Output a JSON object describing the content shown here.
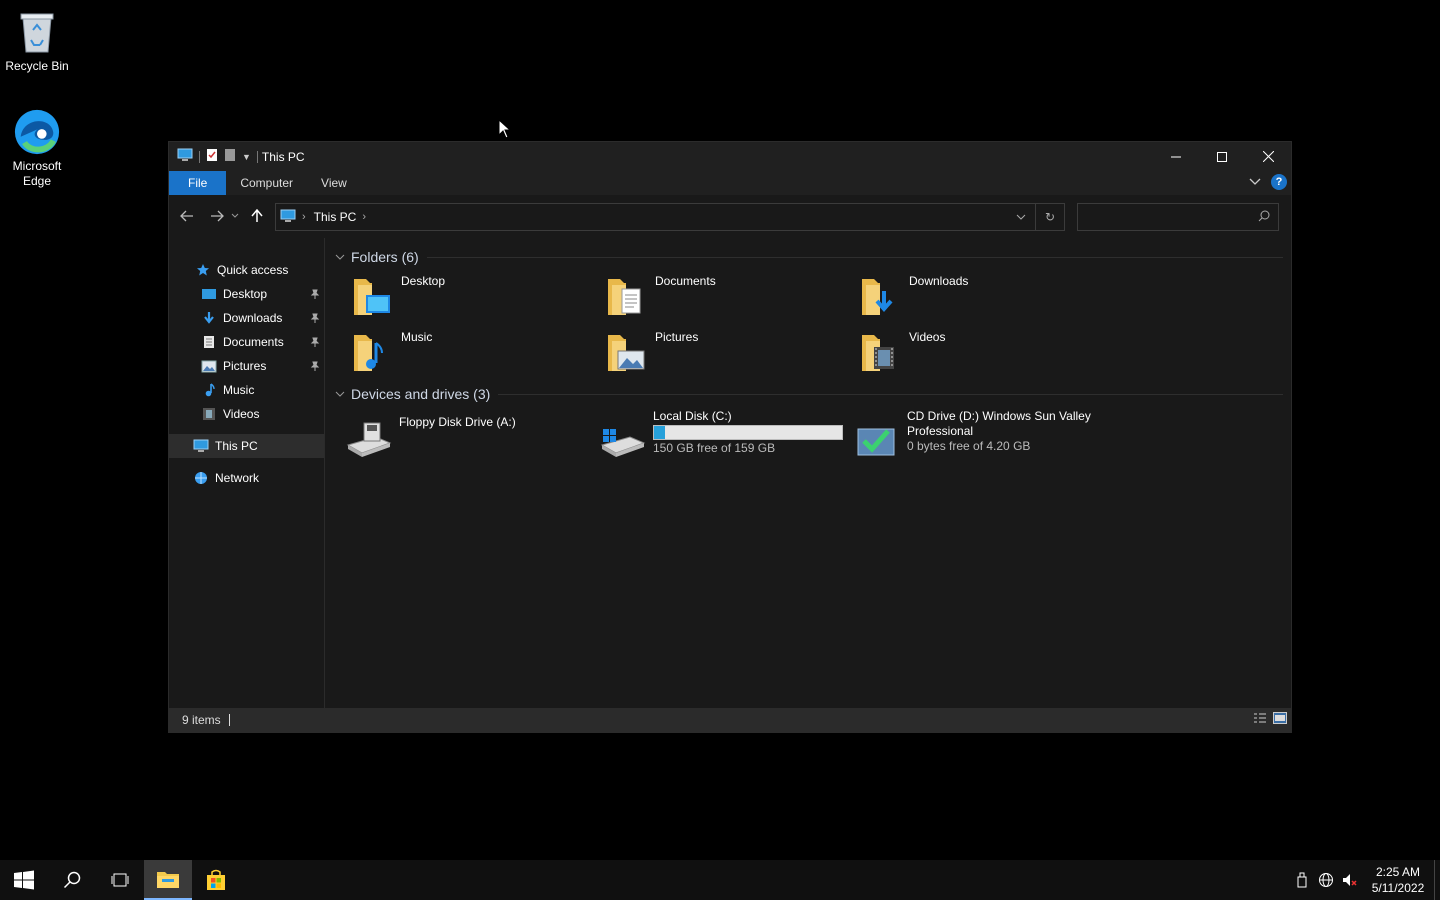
{
  "desktop": {
    "icons": [
      {
        "label": "Recycle Bin",
        "icon": "recycle-bin-icon"
      },
      {
        "label": "Microsoft Edge",
        "icon": "edge-icon"
      }
    ]
  },
  "window": {
    "title": "This PC",
    "ribbon_tabs": [
      "File",
      "Computer",
      "View"
    ],
    "address": {
      "crumb": "This PC"
    },
    "search": {
      "placeholder": "",
      "value": ""
    },
    "sidebar": {
      "quick_access": "Quick access",
      "pinned": [
        {
          "label": "Desktop",
          "pinned": true
        },
        {
          "label": "Downloads",
          "pinned": true
        },
        {
          "label": "Documents",
          "pinned": true
        },
        {
          "label": "Pictures",
          "pinned": true
        },
        {
          "label": "Music",
          "pinned": false
        },
        {
          "label": "Videos",
          "pinned": false
        }
      ],
      "this_pc": "This PC",
      "network": "Network"
    },
    "folders_header": "Folders (6)",
    "folders": [
      "Desktop",
      "Documents",
      "Downloads",
      "Music",
      "Pictures",
      "Videos"
    ],
    "drives_header": "Devices and drives (3)",
    "drives": [
      {
        "name": "Floppy Disk Drive (A:)"
      },
      {
        "name": "Local Disk (C:)",
        "free_text": "150 GB free of 159 GB",
        "used_fraction": 0.057
      },
      {
        "name": "CD Drive (D:) Windows Sun Valley",
        "name_line2": "Professional",
        "free_text": "0 bytes free of 4.20 GB"
      }
    ],
    "status": {
      "items": "9 items"
    }
  },
  "taskbar": {
    "time": "2:25 AM",
    "date": "5/11/2022"
  },
  "colors": {
    "accent": "#1a73c9",
    "folder": "#f2c94c",
    "drive_fill": "#26a0da"
  }
}
